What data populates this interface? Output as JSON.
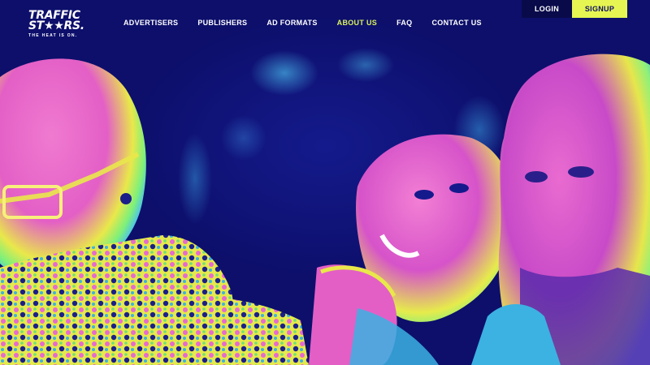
{
  "brand": {
    "logo_line1": "TRAFFIC",
    "logo_line2": "ST★★RS.",
    "tagline": "THE HEAT IS ON."
  },
  "nav": {
    "items": [
      {
        "label": "ADVERTISERS"
      },
      {
        "label": "PUBLISHERS"
      },
      {
        "label": "AD FORMATS"
      },
      {
        "label": "ABOUT US",
        "active": true
      },
      {
        "label": "FAQ"
      },
      {
        "label": "CONTACT US"
      }
    ]
  },
  "auth": {
    "login_label": "LOGIN",
    "signup_label": "SIGNUP"
  },
  "colors": {
    "background": "#0d0f6b",
    "accent": "#e6f551",
    "active_nav": "#d9f25a"
  }
}
